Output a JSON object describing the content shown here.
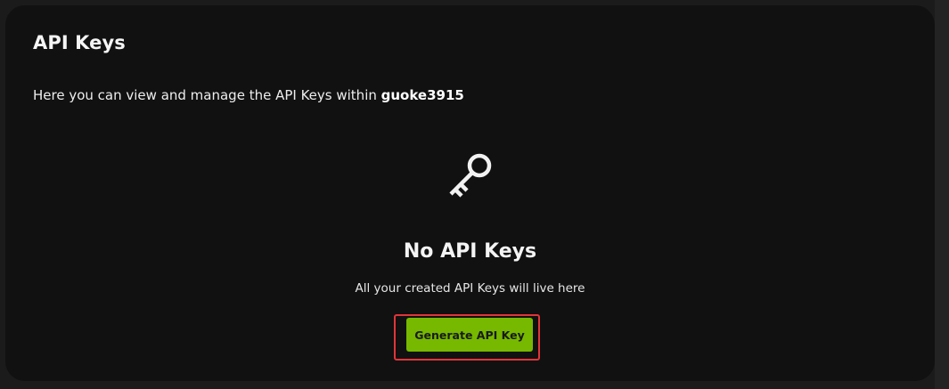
{
  "page": {
    "title": "API Keys",
    "description_prefix": "Here you can view and manage the API Keys within ",
    "org_name": "guoke3915"
  },
  "empty_state": {
    "icon": "key-icon",
    "title": "No API Keys",
    "subtitle": "All your created API Keys will live here"
  },
  "actions": {
    "generate_label": "Generate API Key"
  },
  "colors": {
    "accent": "#76b900",
    "highlight": "#e0353a",
    "panel_bg": "#111111",
    "page_bg": "#1b1b1b"
  }
}
